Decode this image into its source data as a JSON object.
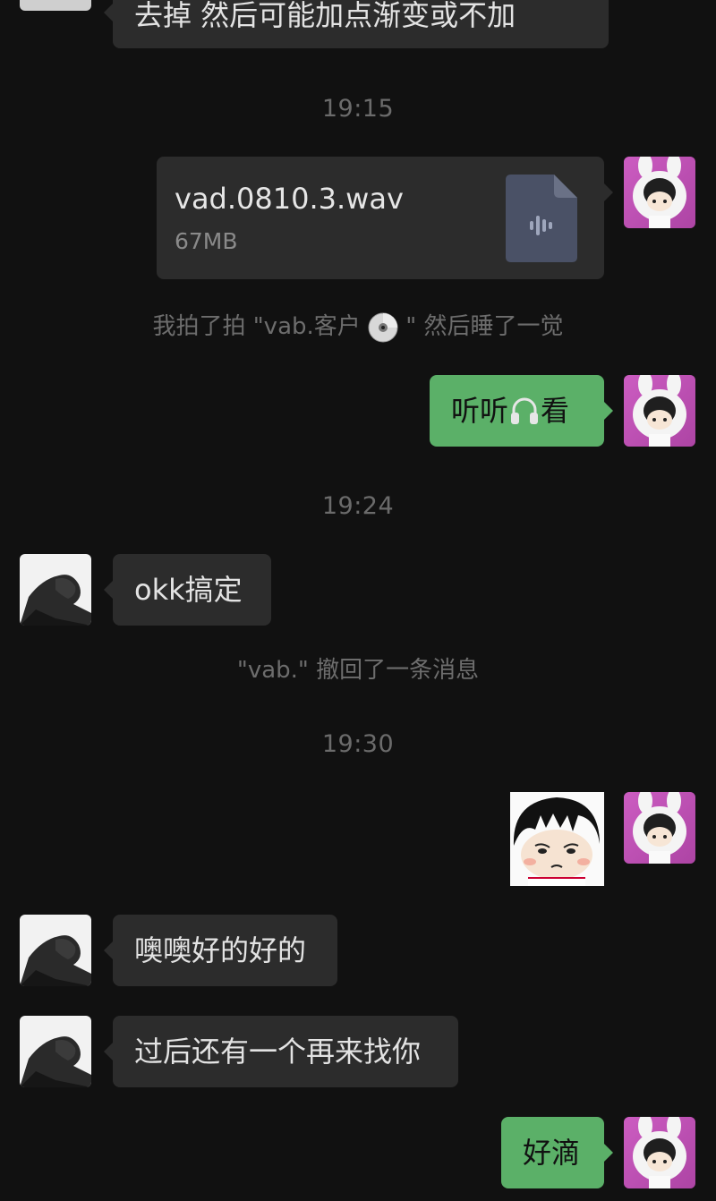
{
  "messages": {
    "top_partial_text": "去掉 然后可能加点渐变或不加",
    "time1": "19:15",
    "file": {
      "name": "vad.0810.3.wav",
      "size": "67MB",
      "icon": "audio-file-icon"
    },
    "pat_notice": {
      "prefix": "我拍了拍 \"vab.客户",
      "emoji": "cd-disc-emoji",
      "suffix": "\" 然后睡了一觉"
    },
    "listen": {
      "before": "听听",
      "emoji": "headphones-emoji",
      "after": "看"
    },
    "time2": "19:24",
    "okk": "okk搞定",
    "recall_notice": "\"vab.\" 撤回了一条消息",
    "time3": "19:30",
    "sticker": "maruko-sticker",
    "ok_reply": "噢噢好的好的",
    "later_reply": "过后还有一个再来找你",
    "final": "好滴"
  },
  "colors": {
    "background": "#111111",
    "incoming_bubble": "#2c2c2c",
    "outgoing_bubble": "#5bb068",
    "system_text": "#6d6d6d"
  }
}
